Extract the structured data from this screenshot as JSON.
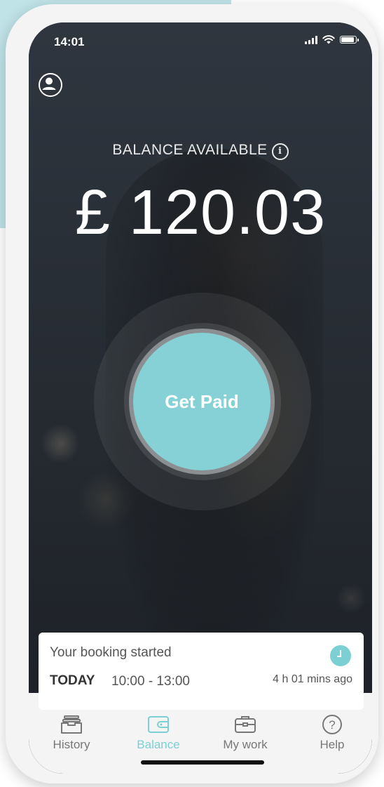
{
  "status_bar": {
    "time": "14:01"
  },
  "balance": {
    "label": "BALANCE AVAILABLE",
    "info_symbol": "i",
    "amount": "£ 120.03"
  },
  "get_paid_label": "Get Paid",
  "booking": {
    "title": "Your booking started",
    "day": "TODAY",
    "time_range": "10:00 - 13:00",
    "elapsed": "4 h 01 mins ago"
  },
  "tabs": [
    {
      "label": "History",
      "icon": "inbox-tray-icon",
      "active": false
    },
    {
      "label": "Balance",
      "icon": "wallet-icon",
      "active": true
    },
    {
      "label": "My work",
      "icon": "briefcase-icon",
      "active": false
    },
    {
      "label": "Help",
      "icon": "question-circle-icon",
      "active": false
    }
  ],
  "colors": {
    "accent": "#86d1d5",
    "active_tab": "#7ccfd3",
    "inactive_tab": "#777777",
    "background_accent": "#bfe3e7"
  }
}
